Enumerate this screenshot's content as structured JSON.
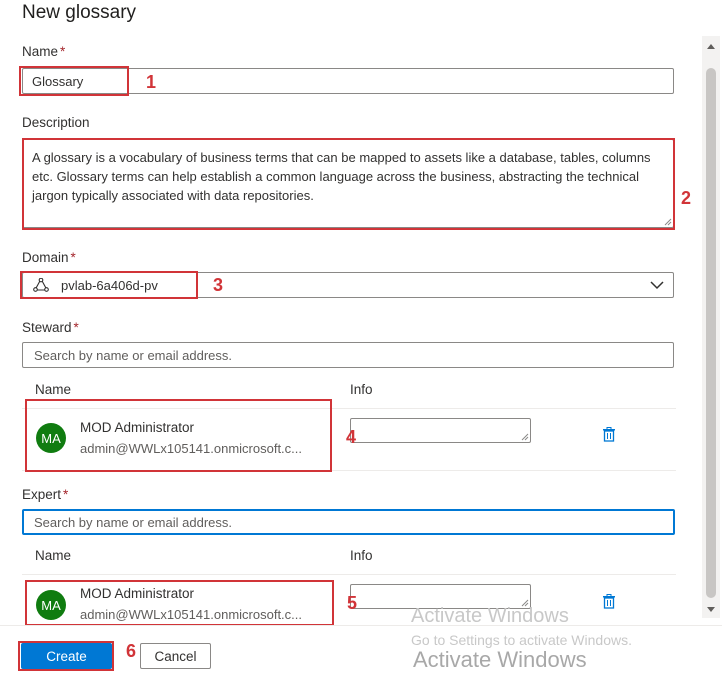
{
  "dialog": {
    "title": "New glossary"
  },
  "name_field": {
    "label": "Name",
    "required_mark": "*",
    "value": "Glossary"
  },
  "description_field": {
    "label": "Description",
    "value": "A glossary is a vocabulary of business terms that can be mapped to assets like a database, tables, columns etc. Glossary terms can help establish a common language across the business, abstracting the technical jargon typically associated with data repositories."
  },
  "domain_field": {
    "label": "Domain",
    "required_mark": "*",
    "value": "pvlab-6a406d-pv"
  },
  "steward": {
    "label": "Steward",
    "required_mark": "*",
    "search_placeholder": "Search by name or email address.",
    "col_name": "Name",
    "col_info": "Info",
    "person": {
      "initials": "MA",
      "name": "MOD Administrator",
      "email": "admin@WWLx105141.onmicrosoft.c..."
    }
  },
  "expert": {
    "label": "Expert",
    "required_mark": "*",
    "search_placeholder": "Search by name or email address.",
    "col_name": "Name",
    "col_info": "Info",
    "person": {
      "initials": "MA",
      "name": "MOD Administrator",
      "email": "admin@WWLx105141.onmicrosoft.c..."
    }
  },
  "footer": {
    "create_label": "Create",
    "cancel_label": "Cancel"
  },
  "annotations": [
    "1",
    "2",
    "3",
    "4",
    "5",
    "6"
  ],
  "watermark": {
    "line1": "Activate Windows",
    "line2": "Go to Settings to activate Windows.",
    "line3": "Activate Windows"
  },
  "colors": {
    "accent": "#0078d4",
    "highlight": "#d13438",
    "avatar": "#107c10"
  }
}
